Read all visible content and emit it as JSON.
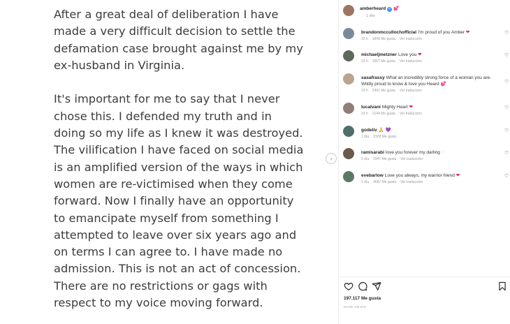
{
  "post": {
    "paragraph1": "After a great deal of deliberation I have made a very difficult decision to settle the defamation case brought against me by my ex-husband in Virginia.",
    "paragraph2": "It's important for me to say that I never chose this. I defended my truth and in doing so my life as I knew it was destroyed. The vilification I have faced on social media is an amplified version of the ways in which women are re-victimised when they come forward.  Now I finally have an opportunity to emancipate myself from something I attempted to leave over six years ago and on terms I can agree to. I have made no admission. This is not an act of concession. There are no restrictions or gags with respect to my voice moving forward."
  },
  "header": {
    "username": "amberheard",
    "verified_mark": "✓",
    "emoji": "💕",
    "time": "1 día"
  },
  "comments": [
    {
      "user": "brandonmccullochofficial",
      "text": "I'm proud of you Amber",
      "emoji": "❤",
      "emoji_color": "#e0245e",
      "time": "22 h",
      "likes": "1849 Me gusta",
      "translate": "Ver traducción"
    },
    {
      "user": "michaeljmetzner",
      "text": "Love you",
      "emoji": "❤",
      "emoji_color": "#e0245e",
      "time": "23 h",
      "likes": "1657 Me gusta",
      "translate": "Ver traducción"
    },
    {
      "user": "sasafrassy",
      "text": "What an incredibly strong force of a woman you are. Wildly proud to know & love you Heard",
      "emoji": "💕",
      "emoji_color": "#e0457a",
      "time": "23 h",
      "likes": "2491 Me gusta",
      "translate": "Ver traducción"
    },
    {
      "user": "lucalvani",
      "text": "Mighty Heart",
      "emoji": "❤",
      "emoji_color": "#e0245e",
      "time": "23 h",
      "likes": "2144 Me gusta",
      "translate": "Ver traducción"
    },
    {
      "user": "godeliv",
      "text": "🙏 💜",
      "emoji": "",
      "emoji_color": "#8b4fd0",
      "time": "1 día",
      "likes": "2328 Me gusta",
      "translate": ""
    },
    {
      "user": "ramisarabi",
      "text": "love you forever my darling",
      "emoji": "♡",
      "emoji_color": "#cccccc",
      "time": "1 día",
      "likes": "2947 Me gusta",
      "translate": "Ver traducción"
    },
    {
      "user": "evebarlow",
      "text": "Love you always, my warrior friend",
      "emoji": "❤",
      "emoji_color": "#e0245e",
      "time": "1 día",
      "likes": "4687 Me gusta",
      "translate": "Ver traducción"
    }
  ],
  "footer": {
    "likes": "197.117 Me gusta",
    "ago": "HACE UN DÍA"
  },
  "icons": [
    "chevron-right-icon",
    "heart-icon",
    "comment-icon",
    "share-icon",
    "bookmark-icon"
  ]
}
